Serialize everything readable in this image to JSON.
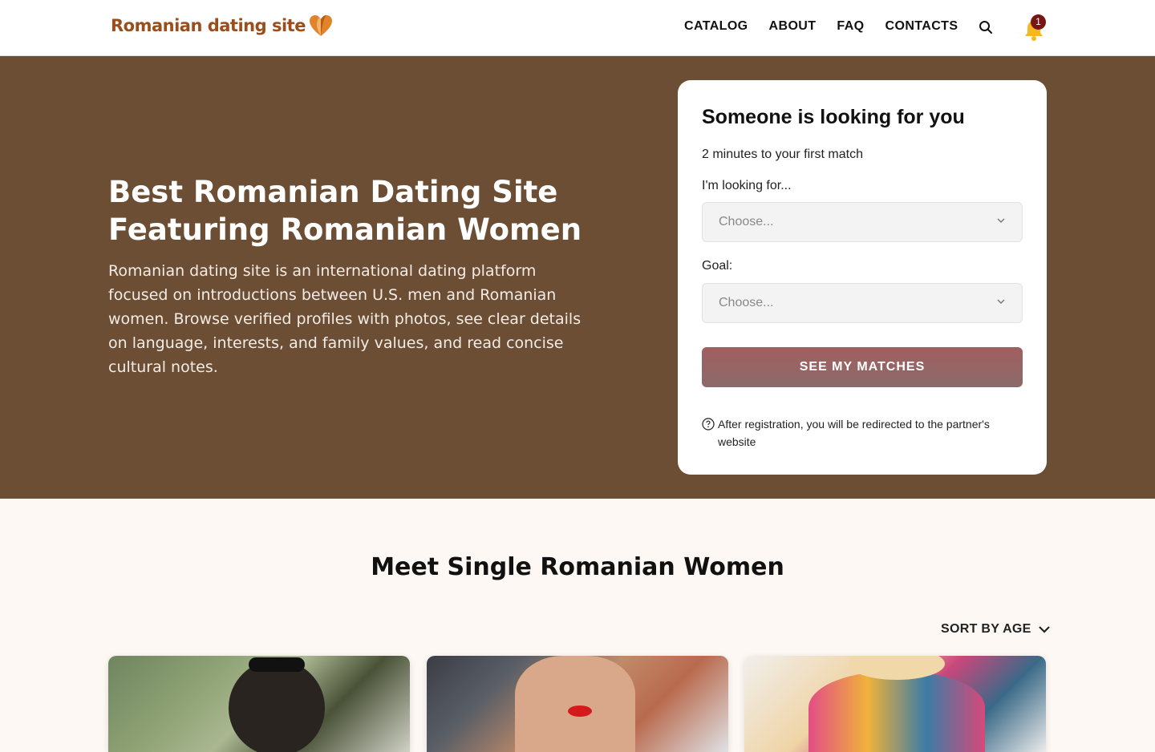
{
  "header": {
    "logo_text": "Romanian dating site",
    "nav": [
      "CATALOG",
      "ABOUT",
      "FAQ",
      "CONTACTS"
    ],
    "notification_count": "1"
  },
  "hero": {
    "title": "Best Romanian Dating Site Featuring Romanian Women",
    "description": "Romanian dating site is an international dating platform focused on introductions between U.S. men and Romanian women. Browse verified profiles with photos, see clear details on language, interests, and family values, and read concise cultural notes."
  },
  "form": {
    "title": "Someone is looking for you",
    "subtitle": "2 minutes to your first match",
    "looking_for_label": "I'm looking for...",
    "looking_for_placeholder": "Choose...",
    "goal_label": "Goal:",
    "goal_placeholder": "Choose...",
    "submit_label": "SEE MY MATCHES",
    "note": "After registration, you will be redirected to the partner's website"
  },
  "catalog": {
    "title": "Meet Single Romanian Women",
    "sort_label": "SORT BY AGE",
    "profiles": [
      {
        "photo": "woman-outdoors-sunglasses"
      },
      {
        "photo": "woman-red-lips-makeup"
      },
      {
        "photo": "woman-blonde-floral-top"
      }
    ]
  },
  "colors": {
    "hero_bg": "#6b4e33",
    "page_bg": "#fdf8f4",
    "cta": "#9a6464",
    "badge": "#7a1515",
    "logo_accent": "#e0832b"
  }
}
